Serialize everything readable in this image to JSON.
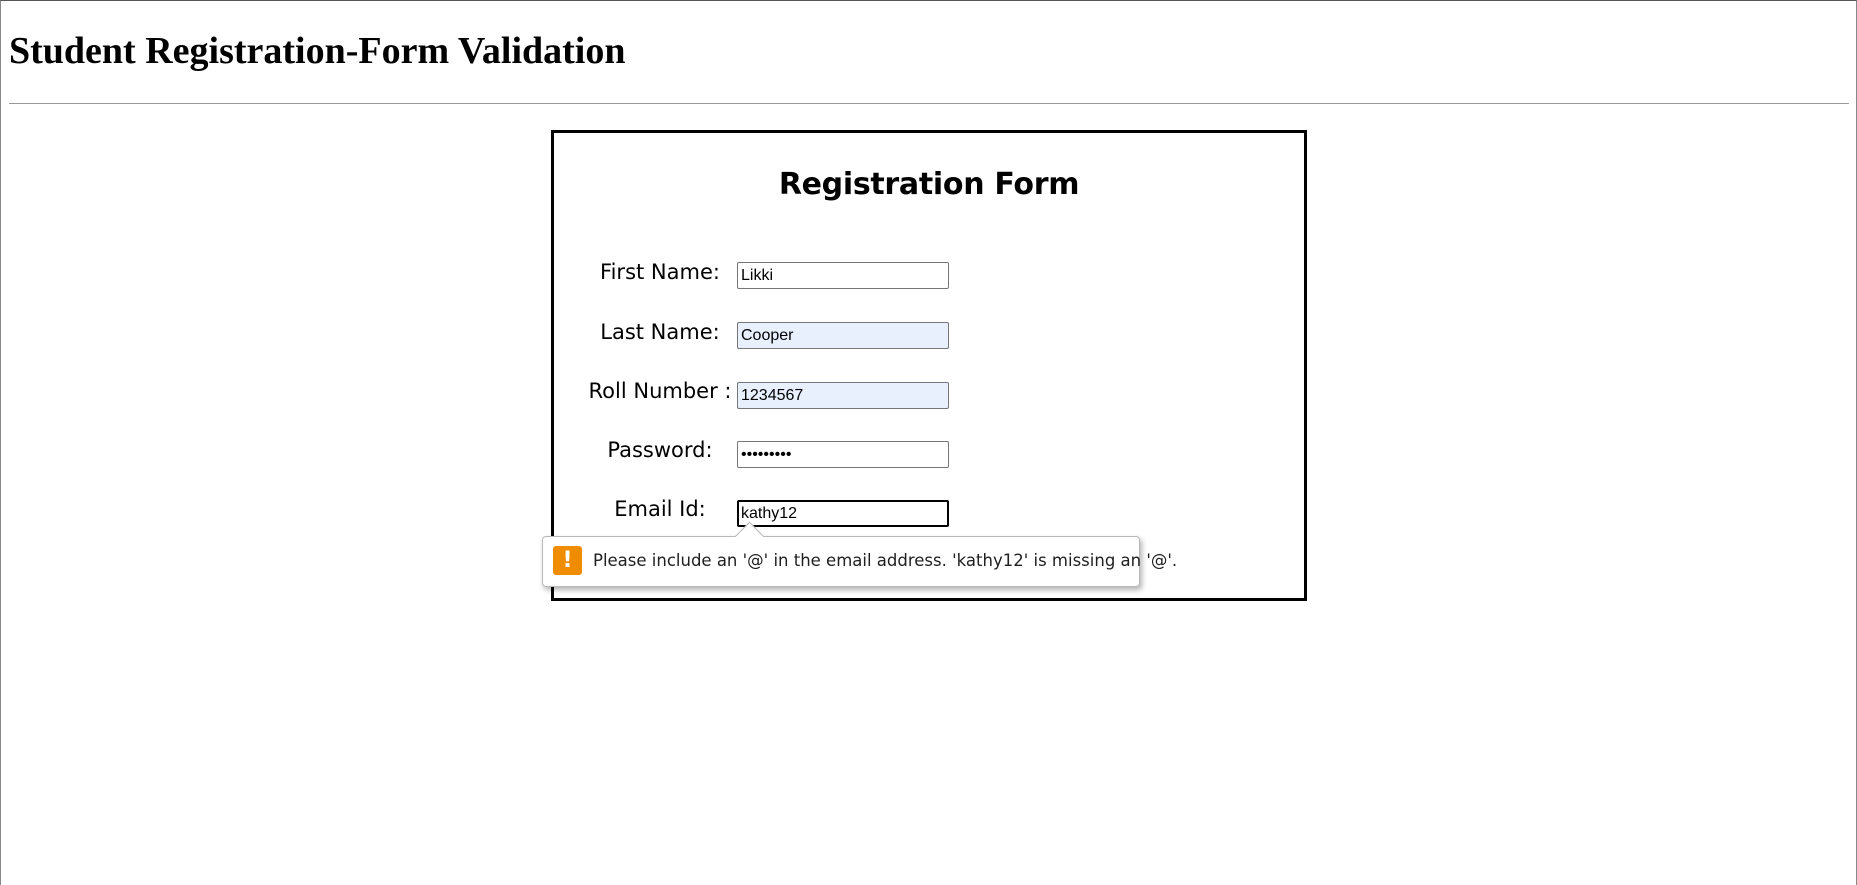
{
  "page": {
    "title": "Student Registration-Form Validation"
  },
  "form": {
    "heading": "Registration Form",
    "fields": [
      {
        "label": "First Name:",
        "value": "Likki",
        "type": "text",
        "autofilled": false
      },
      {
        "label": "Last Name:",
        "value": "Cooper",
        "type": "text",
        "autofilled": true
      },
      {
        "label": "Roll Number :",
        "value": "1234567",
        "type": "text",
        "autofilled": true
      },
      {
        "label": "Password:",
        "value": "•••••••••",
        "type": "password",
        "autofilled": false
      },
      {
        "label": "Email Id:",
        "value": "kathy12",
        "type": "text",
        "autofilled": false,
        "focused": true
      }
    ]
  },
  "validation": {
    "message": "Please include an '@' in the email address. 'kathy12' is missing an '@'.",
    "icon": "warning-icon",
    "icon_glyph": "!",
    "icon_color": "#f08c00"
  }
}
